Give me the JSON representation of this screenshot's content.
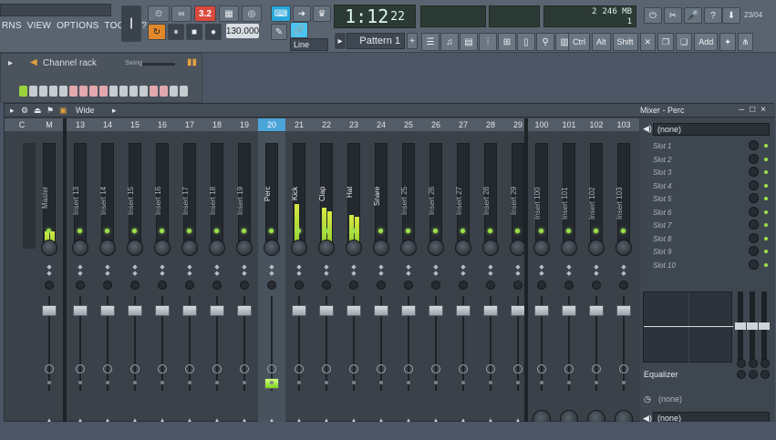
{
  "menu": [
    "RNS",
    "VIEW",
    "OPTIONS",
    "TOOLS",
    "?"
  ],
  "transport": {
    "song_position": "1:12",
    "song_ticks": "22",
    "tempo": "130.000"
  },
  "cpu": {
    "cores": "2",
    "memory": "246 MB",
    "voices": "1"
  },
  "date_label": "23/04",
  "pattern_label": "Pattern 1",
  "line_select": "Line",
  "toolbar_keys": [
    "Ctrl",
    "Alt",
    "Shift",
    "Add"
  ],
  "channel_rack": {
    "title": "Channel rack",
    "swing_label": "Swing"
  },
  "mixer": {
    "view_mode": "Wide",
    "title": "Mixer - Perc",
    "channels": [
      {
        "num": "C",
        "label": ""
      },
      {
        "num": "M",
        "label": "Master"
      },
      {
        "num": "13",
        "label": "Insert 13"
      },
      {
        "num": "14",
        "label": "Insert 14"
      },
      {
        "num": "15",
        "label": "Insert 15"
      },
      {
        "num": "16",
        "label": "Insert 16"
      },
      {
        "num": "17",
        "label": "Insert 17"
      },
      {
        "num": "18",
        "label": "Insert 18"
      },
      {
        "num": "19",
        "label": "Insert 19"
      },
      {
        "num": "20",
        "label": "Perc"
      },
      {
        "num": "21",
        "label": "Kick"
      },
      {
        "num": "22",
        "label": "Clap"
      },
      {
        "num": "23",
        "label": "Hat"
      },
      {
        "num": "24",
        "label": "Snare"
      },
      {
        "num": "25",
        "label": "Insert 25"
      },
      {
        "num": "26",
        "label": "Insert 26"
      },
      {
        "num": "27",
        "label": "Insert 27"
      },
      {
        "num": "28",
        "label": "Insert 28"
      },
      {
        "num": "29",
        "label": "Insert 29"
      },
      {
        "num": "100",
        "label": "Insert 100"
      },
      {
        "num": "101",
        "label": "Insert 101"
      },
      {
        "num": "102",
        "label": "Insert 102"
      },
      {
        "num": "103",
        "label": "Insert 103"
      }
    ],
    "input_select": "(none)",
    "slots": [
      "Slot 1",
      "Slot 2",
      "Slot 3",
      "Slot 4",
      "Slot 5",
      "Slot 6",
      "Slot 7",
      "Slot 8",
      "Slot 9",
      "Slot 10"
    ],
    "equalizer_label": "Equalizer",
    "output_none_1": "(none)",
    "output_none_2": "(none)"
  }
}
